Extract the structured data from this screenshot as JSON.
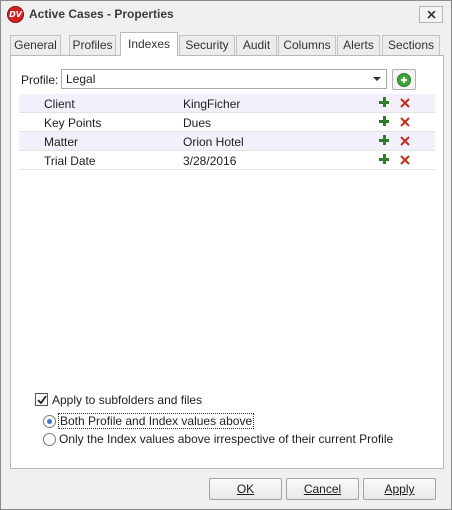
{
  "window": {
    "logo_text": "DV",
    "title": "Active Cases - Properties"
  },
  "tabs": [
    {
      "label": "General",
      "active": false
    },
    {
      "label": "Profiles",
      "active": false
    },
    {
      "label": "Indexes",
      "active": true
    },
    {
      "label": "Security",
      "active": false
    },
    {
      "label": "Audit",
      "active": false
    },
    {
      "label": "Columns",
      "active": false
    },
    {
      "label": "Alerts",
      "active": false
    },
    {
      "label": "Sections",
      "active": false
    }
  ],
  "profile": {
    "label": "Profile:",
    "selected": "Legal"
  },
  "indexes": [
    {
      "name": "Client",
      "value": "KingFicher"
    },
    {
      "name": "Key Points",
      "value": "Dues"
    },
    {
      "name": "Matter",
      "value": "Orion Hotel"
    },
    {
      "name": "Trial Date",
      "value": "3/28/2016"
    }
  ],
  "options": {
    "apply_subfolders_label": "Apply to subfolders and files",
    "apply_subfolders_checked": true,
    "radio_both_label": "Both Profile and Index values above",
    "radio_index_only_label": "Only the Index values above irrespective of their current Profile",
    "selected_radio": "both"
  },
  "buttons": {
    "ok": "OK",
    "cancel": "Cancel",
    "apply": "Apply"
  },
  "colors": {
    "add": "#2e7d2a",
    "delete": "#c62a1f",
    "row_highlight": "#f2f0fa"
  }
}
